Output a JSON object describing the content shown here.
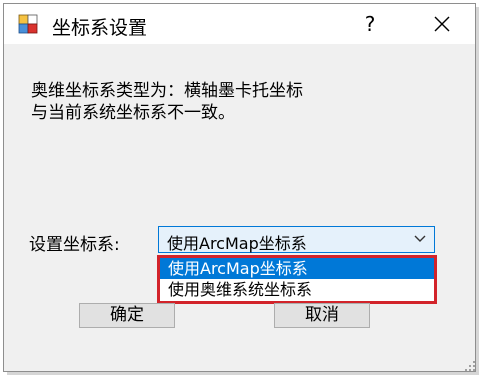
{
  "window": {
    "title": "坐标系设置",
    "help_glyph": "?",
    "close_icon": "close-icon",
    "app_icon": "app-window-icon"
  },
  "message": {
    "line1": "奥维坐标系类型为：横轴墨卡托坐标",
    "line2": "与当前系统坐标系不一致。"
  },
  "coordinate_setting": {
    "label": "设置坐标系:",
    "selected_value": "使用ArcMap坐标系",
    "options": [
      {
        "label": "使用ArcMap坐标系",
        "highlighted": true
      },
      {
        "label": "使用奥维系统坐标系",
        "highlighted": false
      }
    ]
  },
  "buttons": {
    "ok": "确定",
    "cancel": "取消"
  },
  "colors": {
    "accent": "#0078d7",
    "annotation_red": "#d2232a",
    "dialog_bg": "#f0f0f0"
  }
}
